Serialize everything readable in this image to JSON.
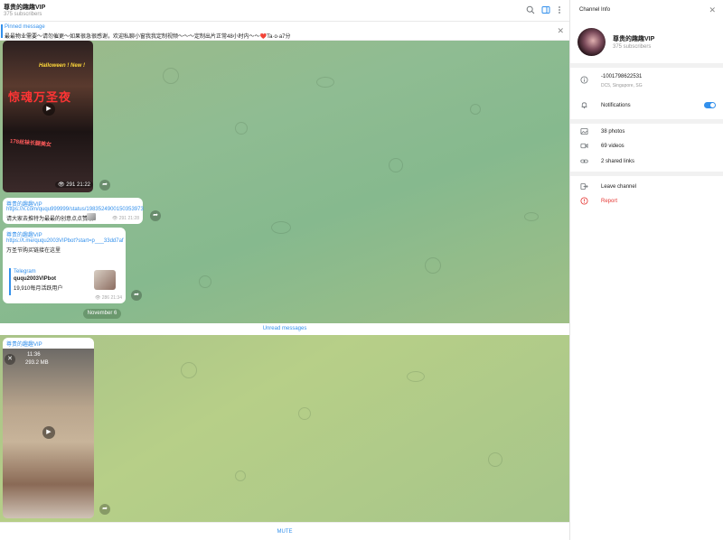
{
  "header": {
    "title": "尊贵的趣趣VIP",
    "subtitle": "375 subscribers",
    "icons": [
      "search-icon",
      "sidebar-toggle-icon",
      "more-vertical-icon"
    ]
  },
  "pinned": {
    "label": "Pinned message",
    "text": "最最物业需要～请勿催更～如果很急很感谢，欢迎私聊小窗我我定制视频～～～定制出片正常48小时内～～❤️Ta·o·a7分"
  },
  "messages": {
    "video1": {
      "title_yellow": "Halloween !  New !",
      "title_red": "惊魂万圣夜",
      "caption_red": "178丝袜长腿美女",
      "views": "291",
      "time": "21:22"
    },
    "msg2": {
      "link": "https://x.com/ququ999999/status/1983524900150353973",
      "text": "请大家去推特为最最的创意点点赞哦",
      "views": "291",
      "time": "21:28"
    },
    "msg3": {
      "sender": "尊贵的趣趣VIP",
      "link": "https://t.me/ququ2003VIPbot?start=p___33dd7af",
      "text": "万圣节购买链接在这里",
      "preview_site": "Telegram",
      "preview_title": "ququ2003VIPbot",
      "preview_desc": "19,910每月活跃用户",
      "views": "286",
      "time": "21:34"
    },
    "date": "November 6",
    "unread": "Unread messages",
    "video2": {
      "sender": "尊贵的趣趣VIP",
      "duration": "11:36",
      "size": "293.2 MB"
    }
  },
  "footer": {
    "mute_label": "MUTE"
  },
  "info_panel": {
    "title": "Channel Info",
    "name": "尊贵的趣趣VIP",
    "subscribers": "375 subscribers",
    "phone": "-1001798622531",
    "dc": "DC5, Singapore, SG",
    "notifications": "Notifications",
    "notifications_on": true,
    "photos": "38 photos",
    "videos": "69 videos",
    "links": "2 shared links",
    "leave": "Leave channel",
    "report": "Report"
  },
  "colors": {
    "accent": "#3390ec",
    "danger": "#e53935"
  }
}
